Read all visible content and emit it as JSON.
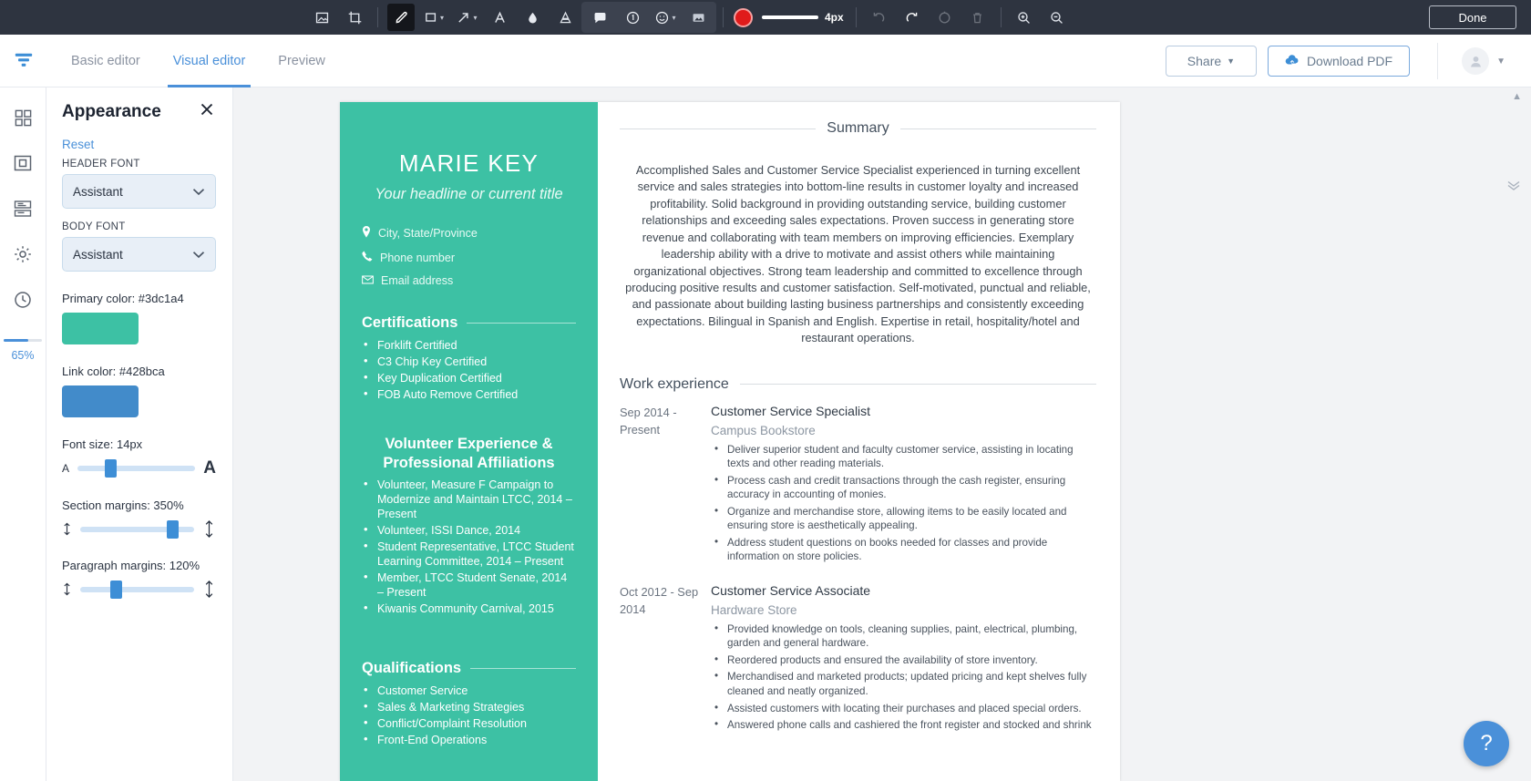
{
  "annotation_toolbar": {
    "tools": [
      {
        "name": "screenshot-icon",
        "label": "Screenshot"
      },
      {
        "name": "crop-icon",
        "label": "Crop"
      },
      {
        "name": "pen-icon",
        "label": "Pen"
      },
      {
        "name": "rectangle-icon",
        "label": "Rectangle"
      },
      {
        "name": "arrow-icon",
        "label": "Arrow"
      },
      {
        "name": "text-icon",
        "label": "Text"
      },
      {
        "name": "blur-icon",
        "label": "Blur"
      },
      {
        "name": "highlight-icon",
        "label": "Highlight"
      },
      {
        "name": "comment-icon",
        "label": "Comment"
      },
      {
        "name": "number-icon",
        "label": "Number"
      },
      {
        "name": "emoji-icon",
        "label": "Emoji"
      },
      {
        "name": "image-icon",
        "label": "Image"
      },
      {
        "name": "color-swatch",
        "label": "Color"
      },
      {
        "name": "undo-icon",
        "label": "Undo"
      },
      {
        "name": "redo-icon",
        "label": "Redo"
      },
      {
        "name": "reset-icon",
        "label": "Reset"
      },
      {
        "name": "trash-icon",
        "label": "Delete"
      },
      {
        "name": "zoom-in-icon",
        "label": "Zoom in"
      },
      {
        "name": "zoom-out-icon",
        "label": "Zoom out"
      }
    ],
    "stroke_width": "4px",
    "stroke_color": "#e01b1b",
    "done_label": "Done"
  },
  "app_header": {
    "tabs": [
      {
        "label": "Basic editor",
        "active": false
      },
      {
        "label": "Visual editor",
        "active": true
      },
      {
        "label": "Preview",
        "active": false
      }
    ],
    "share_label": "Share",
    "download_label": "Download PDF"
  },
  "rail": {
    "items": [
      {
        "name": "templates-icon"
      },
      {
        "name": "layout-icon"
      },
      {
        "name": "sections-icon"
      },
      {
        "name": "settings-icon"
      },
      {
        "name": "history-icon"
      }
    ],
    "progress_percent": "65%",
    "progress_value": 65
  },
  "panel": {
    "title": "Appearance",
    "reset_label": "Reset",
    "header_font_label": "HEADER FONT",
    "header_font_value": "Assistant",
    "body_font_label": "BODY FONT",
    "body_font_value": "Assistant",
    "primary_color_label": "Primary color: #3dc1a4",
    "primary_color_hex": "#3dc1a4",
    "link_color_label": "Link color: #428bca",
    "link_color_hex": "#428bca",
    "font_size_label": "Font size: 14px",
    "font_size_percent": 28,
    "section_margins_label": "Section margins: 350%",
    "section_margins_percent": 81,
    "paragraph_margins_label": "Paragraph margins: 120%",
    "paragraph_margins_percent": 31
  },
  "resume": {
    "name": "MARIE KEY",
    "headline": "Your headline or current title",
    "contact": [
      {
        "icon": "location-pin-icon",
        "text": "City, State/Province"
      },
      {
        "icon": "phone-icon",
        "text": "Phone number"
      },
      {
        "icon": "envelope-icon",
        "text": "Email address"
      }
    ],
    "certifications": {
      "title": "Certifications",
      "items": [
        "Forklift Certified",
        "C3 Chip Key Certified",
        "Key Duplication Certified",
        "FOB Auto Remove Certified"
      ]
    },
    "volunteer": {
      "title_line1": "Volunteer Experience &",
      "title_line2": "Professional Affiliations",
      "items": [
        "Volunteer, Measure F Campaign to Modernize and Maintain LTCC, 2014 – Present",
        "Volunteer, ISSI Dance, 2014",
        "Student Representative, LTCC Student Learning Committee, 2014 – Present",
        "Member, LTCC Student Senate, 2014 – Present",
        "Kiwanis Community Carnival, 2015"
      ]
    },
    "qualifications": {
      "title": "Qualifications",
      "items": [
        "Customer Service",
        "Sales & Marketing Strategies",
        "Conflict/Complaint Resolution",
        "Front-End Operations"
      ]
    },
    "summary": {
      "title": "Summary",
      "text": "Accomplished Sales and Customer Service Specialist experienced in turning excellent service and sales strategies into bottom-line results in customer loyalty and increased profitability. Solid background in providing outstanding service, building customer relationships and exceeding sales expectations. Proven success in generating store revenue and collaborating with team members on improving efficiencies. Exemplary leadership ability with a drive to motivate and assist others while maintaining organizational objectives. Strong team leadership and committed to excellence through producing positive results and customer satisfaction. Self-motivated, punctual and reliable, and passionate about building lasting business partnerships and consistently exceeding expectations. Bilingual in Spanish and English. Expertise in retail, hospitality/hotel and restaurant operations."
    },
    "work_experience": {
      "title": "Work experience",
      "jobs": [
        {
          "dates": "Sep 2014 - Present",
          "role": "Customer Service Specialist",
          "organization": "Campus Bookstore",
          "bullets": [
            "Deliver superior student and faculty customer service, assisting in locating texts and other reading materials.",
            "Process cash and credit transactions through the cash register, ensuring accuracy in accounting of monies.",
            "Organize and merchandise store, allowing items to be easily located and ensuring store is aesthetically appealing.",
            "Address student questions on books needed for classes and provide information on store policies."
          ]
        },
        {
          "dates": "Oct 2012 - Sep 2014",
          "role": "Customer Service Associate",
          "organization": "Hardware Store",
          "bullets": [
            "Provided knowledge on tools, cleaning supplies, paint, electrical, plumbing, garden and general hardware.",
            "Reordered products and ensured the availability of store inventory.",
            "Merchandised and marketed products; updated pricing and kept shelves fully cleaned and neatly organized.",
            "Assisted customers with locating their purchases and placed special orders.",
            "Answered phone calls and cashiered the front register and stocked and shrink"
          ]
        }
      ]
    }
  },
  "help": {
    "label": "?"
  }
}
